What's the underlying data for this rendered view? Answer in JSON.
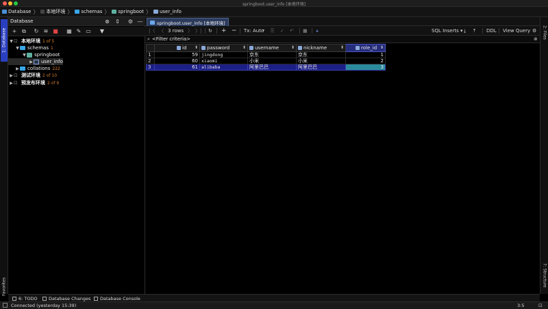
{
  "window": {
    "title": "springboot.user_info [本地环境]"
  },
  "nav": {
    "crumbs": [
      "Database",
      "本地环境",
      "schemas",
      "springboot",
      "user_info"
    ]
  },
  "left_strip": {
    "database_tab": "1: Database",
    "favorites_tab": "Favorites"
  },
  "right_strip": {
    "files_tab": "2: Files",
    "structure_tab": "7: Structure"
  },
  "db_panel": {
    "title": "Database",
    "tree": [
      {
        "label": "本地环境",
        "count": "1 of 5"
      },
      {
        "label": "schemas",
        "count": "1"
      },
      {
        "label": "springboot",
        "count": ""
      },
      {
        "label": "user_info",
        "count": ""
      },
      {
        "label": "collations",
        "count": "222"
      },
      {
        "label": "测试环境",
        "count": "2 of 10"
      },
      {
        "label": "预发布环境",
        "count": "2 of 9"
      }
    ]
  },
  "editor": {
    "tab_label": "springboot.user_info [本地环境]",
    "toolbar": {
      "rows_label": "3 rows",
      "tx_label": "Tx: Auto",
      "sql_inserts_label": "SQL Inserts",
      "ddl_label": "DDL",
      "view_query_label": "View Query"
    },
    "filter_placeholder": "<Filter criteria>",
    "grid": {
      "columns": [
        "id",
        "password",
        "username",
        "nickname",
        "role_id"
      ],
      "rows": [
        {
          "rownum": "1",
          "id": "59",
          "password": "jingdong",
          "username": "京东",
          "nickname": "京东",
          "role_id": "1"
        },
        {
          "rownum": "2",
          "id": "60",
          "password": "xiaomi",
          "username": "小米",
          "nickname": "小米",
          "role_id": "2"
        },
        {
          "rownum": "3",
          "id": "61",
          "password": "alibaba",
          "username": "阿里巴巴",
          "nickname": "阿里巴巴",
          "role_id": "3"
        }
      ],
      "selected_row": 3,
      "selected_column": "role_id"
    }
  },
  "bottom_tabs": {
    "todo": "6: TODO",
    "changes": "Database Changes",
    "console": "Database Console"
  },
  "status": {
    "message": "Connected (yesterday 15:39)",
    "position": "3:5"
  },
  "colors": {
    "accent": "#2a3fc0",
    "folder": "#39a6e8",
    "count": "#e0822f",
    "selected_cell": "#2a8a9c"
  }
}
